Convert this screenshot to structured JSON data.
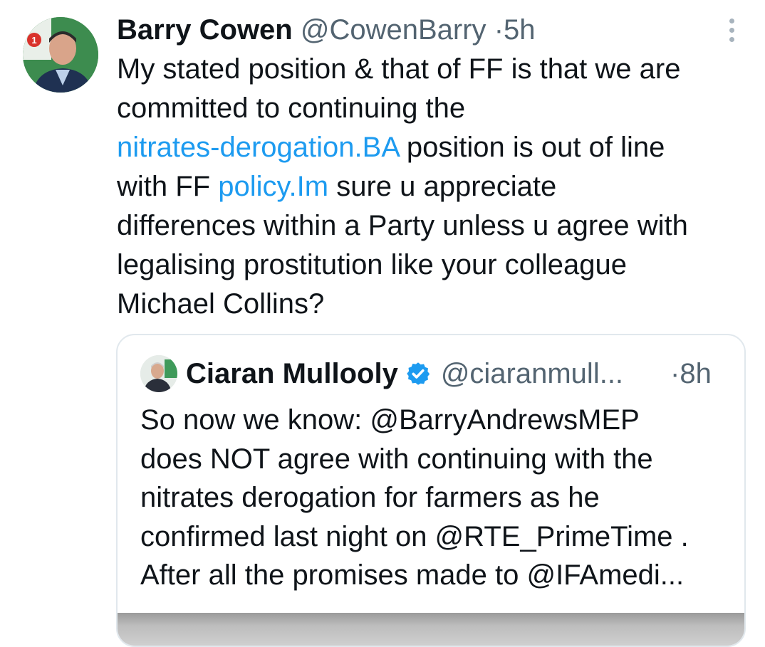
{
  "tweet": {
    "avatar_icon": "profile-photo-man-with-badge",
    "author_name": "Barry Cowen",
    "author_handle": "@CowenBarry",
    "separator": "·",
    "time": "5h",
    "more_icon": "vertical-ellipsis-icon",
    "text_lines": [
      [
        {
          "text": "My stated position & that of FF is that we are"
        }
      ],
      [
        {
          "text": "committed to continuing the"
        }
      ],
      [
        {
          "text": "nitrates-derogation.BA",
          "link": true
        },
        {
          "text": " position is out of line"
        }
      ],
      [
        {
          "text": "with FF "
        },
        {
          "text": "policy.Im",
          "link": true
        },
        {
          "text": " sure u appreciate"
        }
      ],
      [
        {
          "text": "differences within a Party unless u agree with"
        }
      ],
      [
        {
          "text": "legalising prostitution like your colleague"
        }
      ],
      [
        {
          "text": "Michael Collins?"
        }
      ]
    ]
  },
  "quoted_tweet": {
    "avatar_icon": "profile-photo-man-in-suit",
    "author_name": "Ciaran Mullooly",
    "verified_icon": "verified-badge-icon",
    "author_handle": "@ciaranmull...",
    "separator": "·",
    "time": "8h",
    "text_lines": [
      "So now we know: @BarryAndrewsMEP",
      "does NOT agree with continuing with the",
      "nitrates derogation for farmers as he",
      "confirmed last night on @RTE_PrimeTime .",
      "After all the promises made to @IFAmedi..."
    ]
  },
  "colors": {
    "text": "#0f1419",
    "muted": "#536471",
    "link": "#1d9bf0",
    "border": "#e1e8ed"
  }
}
